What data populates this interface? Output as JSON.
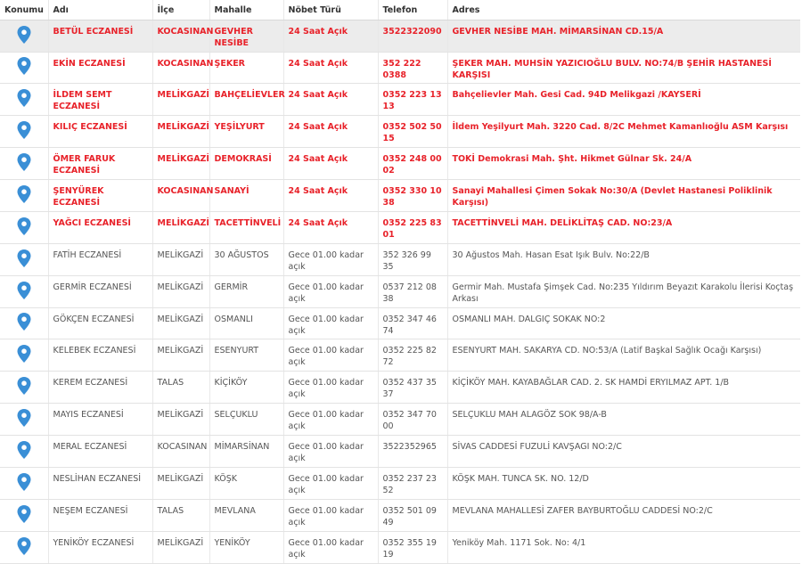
{
  "colors": {
    "on_duty": "#e8222a",
    "pin": "#3a8fd6",
    "header_bg": "#ffffff",
    "highlight_row": "#ececec"
  },
  "table": {
    "headers": {
      "location": "Konumu",
      "name": "Adı",
      "district": "İlçe",
      "neighborhood": "Mahalle",
      "duty_type": "Nöbet Türü",
      "phone": "Telefon",
      "address": "Adres"
    },
    "rows": [
      {
        "icon": "map-pin-icon",
        "name": "BETÜL ECZANESİ",
        "district": "KOCASINAN",
        "neighborhood": "GEVHER NESİBE",
        "duty_type": "24 Saat Açık",
        "phone": "3522322090",
        "address": "GEVHER NESİBE MAH. MİMARSİNAN CD.15/A",
        "on_duty": true
      },
      {
        "icon": "map-pin-icon",
        "name": "EKİN ECZANESİ",
        "district": "KOCASINAN",
        "neighborhood": "ŞEKER",
        "duty_type": "24 Saat Açık",
        "phone": "352 222 0388",
        "address": "ŞEKER MAH. MUHSİN YAZICIOĞLU BULV. NO:74/B ŞEHİR HASTANESİ KARŞISI",
        "on_duty": true
      },
      {
        "icon": "map-pin-icon",
        "name": "İLDEM SEMT ECZANESİ",
        "district": "MELİKGAZİ",
        "neighborhood": "BAHÇELİEVLER",
        "duty_type": "24 Saat Açık",
        "phone": "0352 223 13 13",
        "address": "Bahçelievler Mah. Gesi Cad. 94D Melikgazi /KAYSERİ",
        "on_duty": true
      },
      {
        "icon": "map-pin-icon",
        "name": "KILIÇ ECZANESİ",
        "district": "MELİKGAZİ",
        "neighborhood": "YEŞİLYURT",
        "duty_type": "24 Saat Açık",
        "phone": "0352 502 50 15",
        "address": "İldem Yeşilyurt Mah. 3220 Cad. 8/2C Mehmet Kamanlıoğlu ASM Karşısı",
        "on_duty": true
      },
      {
        "icon": "map-pin-icon",
        "name": "ÖMER FARUK ECZANESİ",
        "district": "MELİKGAZİ",
        "neighborhood": "DEMOKRASİ",
        "duty_type": "24 Saat Açık",
        "phone": "0352 248 00 02",
        "address": "TOKİ Demokrasi Mah. Şht. Hikmet Gülnar Sk. 24/A",
        "on_duty": true
      },
      {
        "icon": "map-pin-icon",
        "name": "ŞENYÜREK ECZANESİ",
        "district": "KOCASINAN",
        "neighborhood": "SANAYİ",
        "duty_type": "24 Saat Açık",
        "phone": "0352 330 10 38",
        "address": "Sanayi Mahallesi Çimen Sokak No:30/A (Devlet Hastanesi Poliklinik Karşısı)",
        "on_duty": true
      },
      {
        "icon": "map-pin-icon",
        "name": "YAĞCI ECZANESİ",
        "district": "MELİKGAZİ",
        "neighborhood": "TACETTİNVELİ",
        "duty_type": "24 Saat Açık",
        "phone": "0352 225 83 01",
        "address": "TACETTİNVELİ MAH. DELİKLİTAŞ CAD. NO:23/A",
        "on_duty": true
      },
      {
        "icon": "map-pin-icon",
        "name": "FATİH ECZANESİ",
        "district": "MELİKGAZİ",
        "neighborhood": "30 AĞUSTOS",
        "duty_type": "Gece 01.00 kadar açık",
        "phone": "352 326 99 35",
        "address": "30 Ağustos Mah. Hasan Esat Işık Bulv. No:22/B",
        "on_duty": false
      },
      {
        "icon": "map-pin-icon",
        "name": "GERMİR ECZANESİ",
        "district": "MELİKGAZİ",
        "neighborhood": "GERMİR",
        "duty_type": "Gece 01.00 kadar açık",
        "phone": "0537 212 08 38",
        "address": "Germir Mah. Mustafa Şimşek Cad. No:235 Yıldırım Beyazıt Karakolu İlerisi Koçtaş Arkası",
        "on_duty": false
      },
      {
        "icon": "map-pin-icon",
        "name": "GÖKÇEN ECZANESİ",
        "district": "MELİKGAZİ",
        "neighborhood": "OSMANLI",
        "duty_type": "Gece 01.00 kadar açık",
        "phone": "0352 347 46 74",
        "address": "OSMANLI MAH. DALGIÇ SOKAK NO:2",
        "on_duty": false
      },
      {
        "icon": "map-pin-icon",
        "name": "KELEBEK ECZANESİ",
        "district": "MELİKGAZİ",
        "neighborhood": "ESENYURT",
        "duty_type": "Gece 01.00 kadar açık",
        "phone": "0352 225 82 72",
        "address": "ESENYURT MAH. SAKARYA CD. NO:53/A (Latif Başkal Sağlık Ocağı Karşısı)",
        "on_duty": false
      },
      {
        "icon": "map-pin-icon",
        "name": "KEREM ECZANESİ",
        "district": "TALAS",
        "neighborhood": "KİÇİKÖY",
        "duty_type": "Gece 01.00 kadar açık",
        "phone": "0352 437 35 37",
        "address": "KİÇİKÖY MAH. KAYABAĞLAR CAD. 2. SK HAMDİ ERYILMAZ APT. 1/B",
        "on_duty": false
      },
      {
        "icon": "map-pin-icon",
        "name": "MAYIS ECZANESİ",
        "district": "MELİKGAZİ",
        "neighborhood": "SELÇUKLU",
        "duty_type": "Gece 01.00 kadar açık",
        "phone": "0352 347 70 00",
        "address": "SELÇUKLU MAH ALAGÖZ SOK 98/A-B",
        "on_duty": false
      },
      {
        "icon": "map-pin-icon",
        "name": "MERAL ECZANESİ",
        "district": "KOCASINAN",
        "neighborhood": "MİMARSİNAN",
        "duty_type": "Gece 01.00 kadar açık",
        "phone": "3522352965",
        "address": "SİVAS CADDESİ FUZULİ KAVŞAGI NO:2/C",
        "on_duty": false
      },
      {
        "icon": "map-pin-icon",
        "name": "NESLİHAN ECZANESİ",
        "district": "MELİKGAZİ",
        "neighborhood": "KÖŞK",
        "duty_type": "Gece 01.00 kadar açık",
        "phone": "0352 237 23 52",
        "address": "KÖŞK MAH. TUNCA SK. NO. 12/D",
        "on_duty": false
      },
      {
        "icon": "map-pin-icon",
        "name": "NEŞEM ECZANESİ",
        "district": "TALAS",
        "neighborhood": "MEVLANA",
        "duty_type": "Gece 01.00 kadar açık",
        "phone": "0352 501 09 49",
        "address": "MEVLANA MAHALLESİ ZAFER BAYBURTOĞLU CADDESİ NO:2/C",
        "on_duty": false
      },
      {
        "icon": "map-pin-icon",
        "name": "YENİKÖY ECZANESİ",
        "district": "MELİKGAZİ",
        "neighborhood": "YENİKÖY",
        "duty_type": "Gece 01.00 kadar açık",
        "phone": "0352 355 19 19",
        "address": "Yeniköy Mah. 1171 Sok. No: 4/1",
        "on_duty": false
      }
    ]
  }
}
